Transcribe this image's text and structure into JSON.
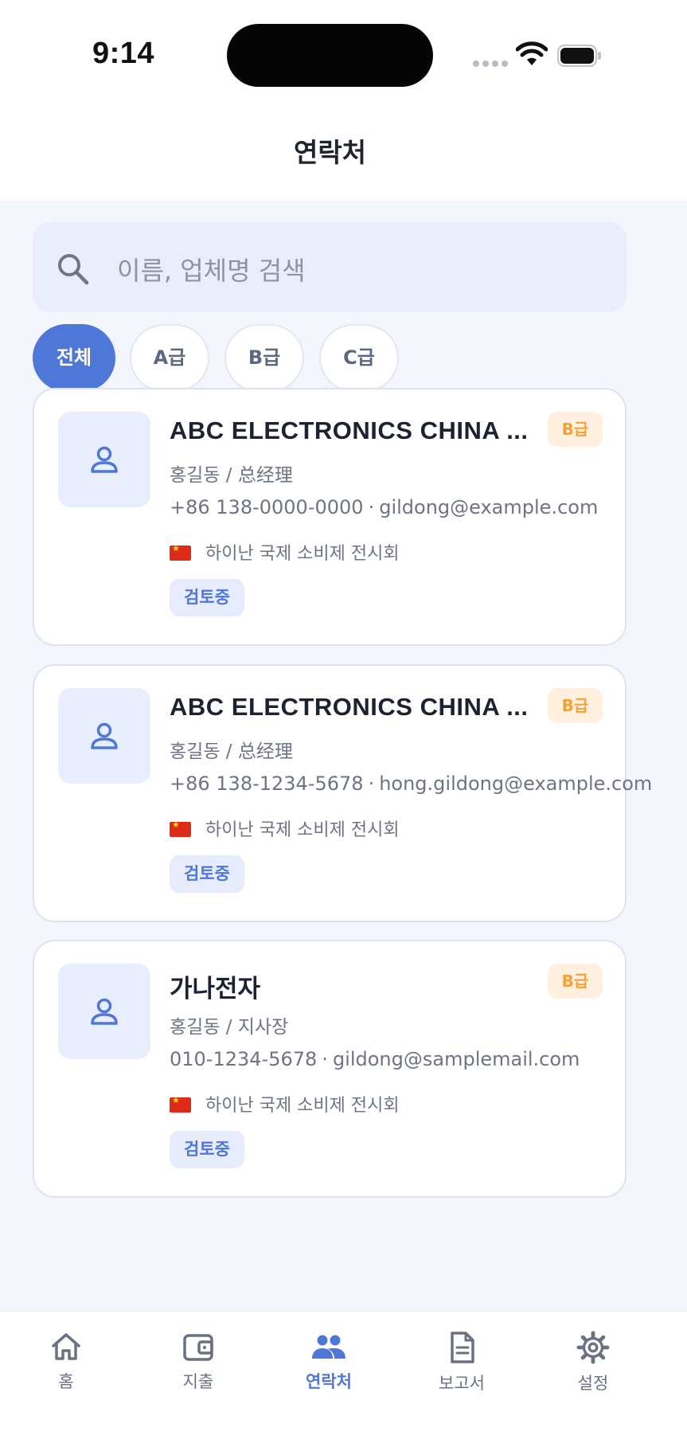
{
  "status_bar": {
    "time": "9:14"
  },
  "header": {
    "title": "연락처"
  },
  "search": {
    "placeholder": "이름, 업체명 검색"
  },
  "filters": [
    {
      "label": "전체",
      "active": true
    },
    {
      "label": "A급",
      "active": false
    },
    {
      "label": "B급",
      "active": false
    },
    {
      "label": "C급",
      "active": false
    }
  ],
  "contacts": [
    {
      "company": "ABC ELECTRONICS CHINA ...",
      "grade": "B급",
      "person": "홍길동 / 总经理",
      "phone": "+86 138-0000-0000",
      "separator": "·",
      "email": "gildong@example.com",
      "exhibition": "하이난 국제 소비제 전시회",
      "status": "검토중"
    },
    {
      "company": "ABC ELECTRONICS CHINA ...",
      "grade": "B급",
      "person": "홍길동 / 总经理",
      "phone": "+86 138-1234-5678",
      "separator": "·",
      "email": "hong.gildong@example.com",
      "exhibition": "하이난 국제 소비제 전시회",
      "status": "검토중"
    },
    {
      "company": "가나전자",
      "grade": "B급",
      "person": "홍길동 / 지사장",
      "phone": "010-1234-5678",
      "separator": "·",
      "email": "gildong@samplemail.com",
      "exhibition": "하이난 국제 소비제 전시회",
      "status": "검토중"
    }
  ],
  "tabbar": {
    "items": [
      {
        "label": "홈",
        "icon": "home-icon",
        "active": false
      },
      {
        "label": "지출",
        "icon": "wallet-icon",
        "active": false
      },
      {
        "label": "연락처",
        "icon": "people-icon",
        "active": true
      },
      {
        "label": "보고서",
        "icon": "document-icon",
        "active": false
      },
      {
        "label": "설정",
        "icon": "gear-icon",
        "active": false
      }
    ]
  },
  "colors": {
    "accent": "#4f77d8",
    "grade_badge": "#f3a238",
    "status_badge_bg": "#e6ecfb"
  }
}
